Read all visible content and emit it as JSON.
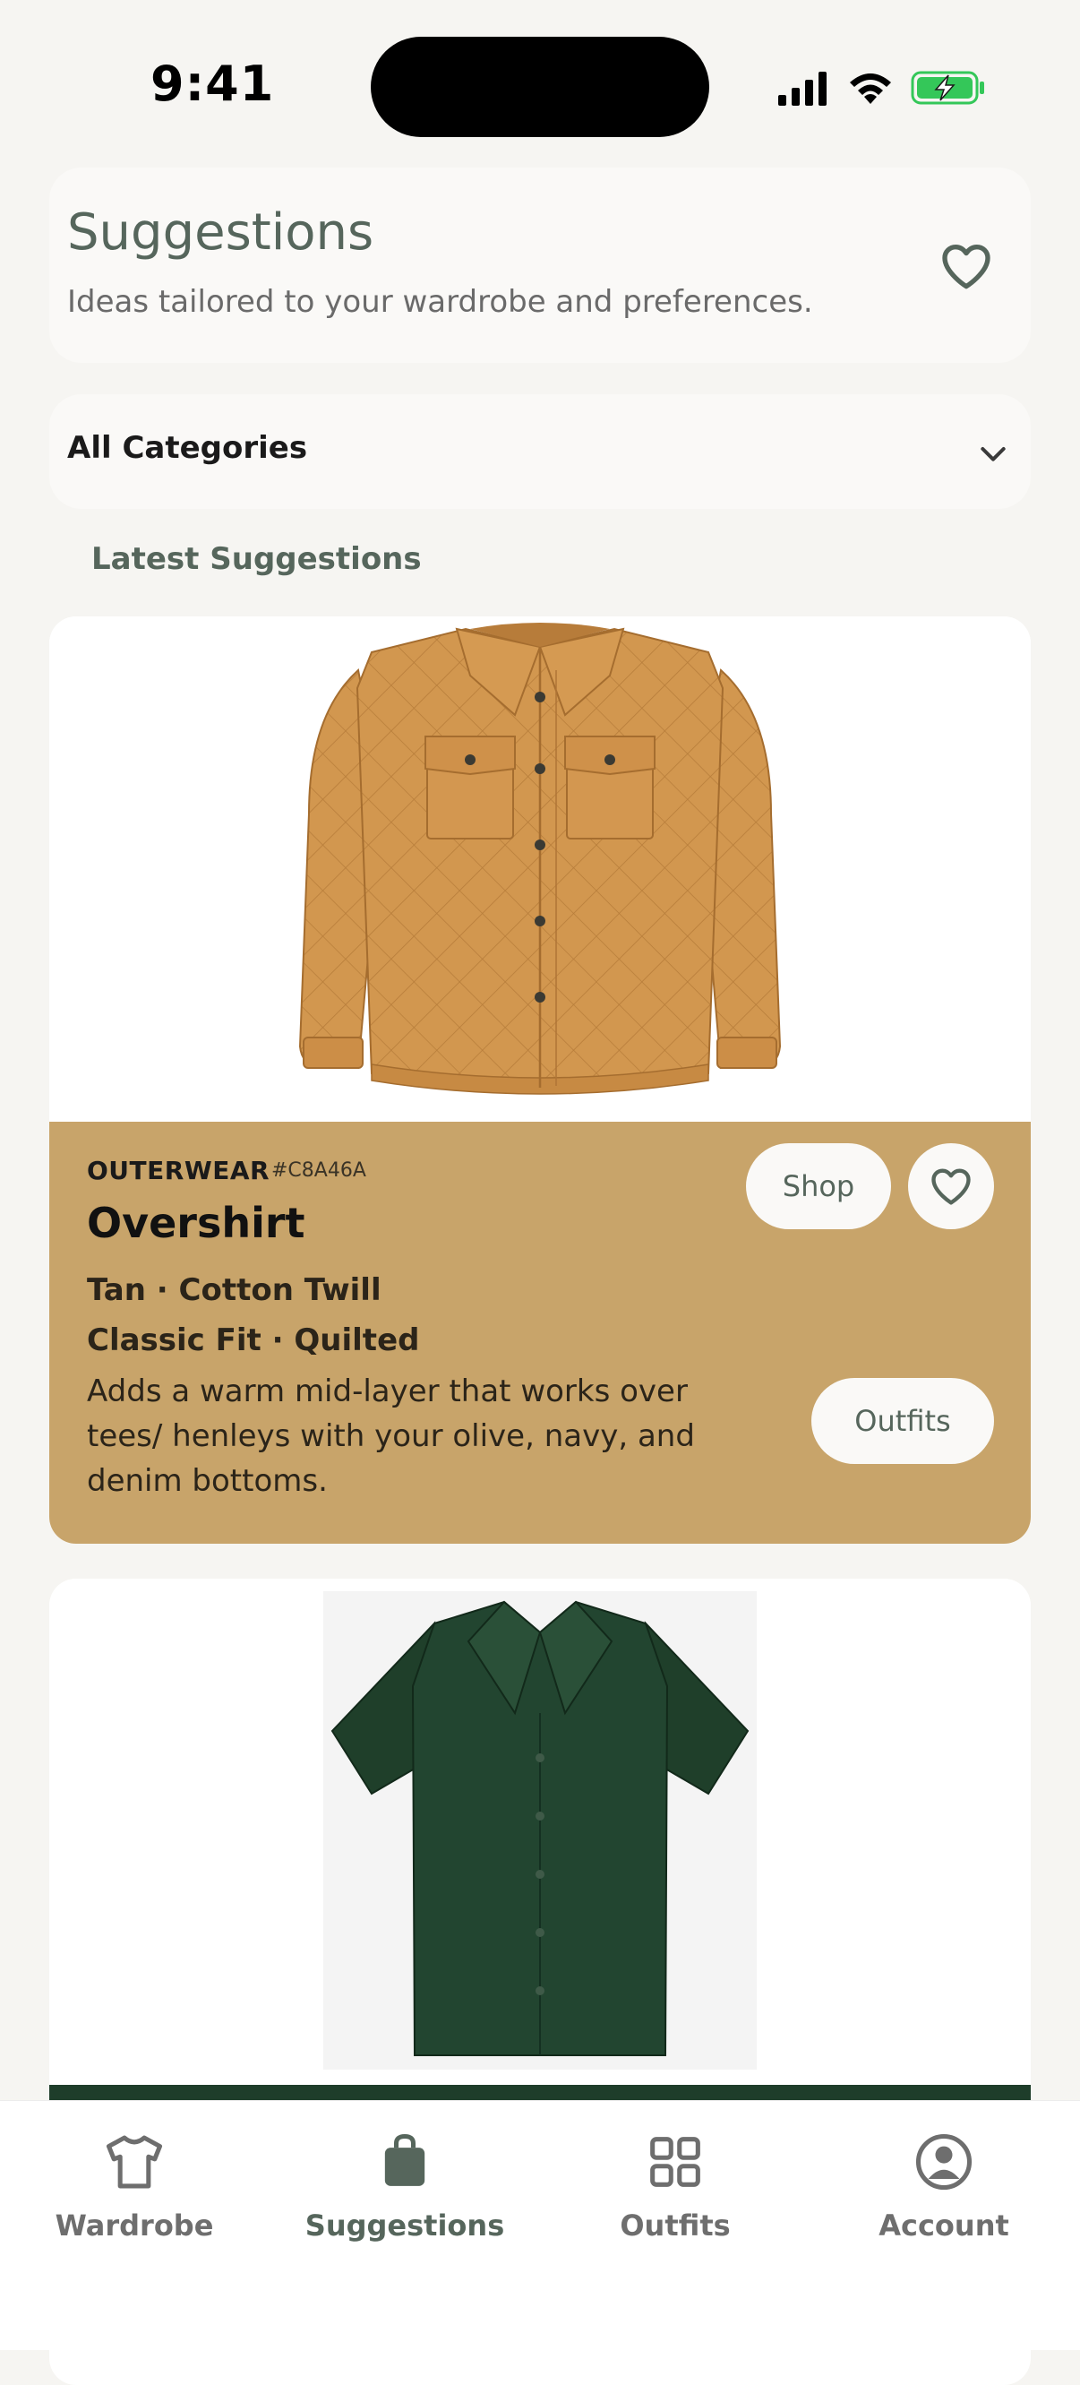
{
  "status_bar": {
    "time": "9:41",
    "icons": [
      "signal-icon",
      "wifi-icon",
      "battery-charging-icon"
    ]
  },
  "header": {
    "title": "Suggestions",
    "subtitle": "Ideas tailored to your wardrobe and preferences.",
    "favorites_icon": "heart-outline-icon"
  },
  "filter": {
    "selected": "All Categories",
    "icon": "chevron-down-icon"
  },
  "section": {
    "title": "Latest Suggestions"
  },
  "suggestions": [
    {
      "category": "OUTERWEAR",
      "hex": "#C8A46A",
      "name": "Overshirt",
      "attr_line_1": "Tan · Cotton Twill",
      "attr_line_2": "Classic Fit · Quilted",
      "description": "Adds a warm mid-layer that works over tees/ henleys with your olive, navy, and denim bottoms.",
      "shop_label": "Shop",
      "outfits_label": "Outfits",
      "image": "tan-quilted-overshirt-image",
      "color": "#C8A46A"
    },
    {
      "image": "dark-green-camp-collar-shirt-image",
      "color": "#1E3D2A"
    }
  ],
  "tab_bar": {
    "items": [
      {
        "label": "Wardrobe",
        "icon": "tshirt-icon",
        "active": false
      },
      {
        "label": "Suggestions",
        "icon": "shopping-bag-icon",
        "active": true
      },
      {
        "label": "Outfits",
        "icon": "grid-icon",
        "active": false
      },
      {
        "label": "Account",
        "icon": "user-circle-icon",
        "active": false
      }
    ]
  },
  "colors": {
    "background": "#f6f5f2",
    "accent_sage": "#56665c",
    "card_tan": "#c8a46a",
    "card_dark_green": "#1e3d2a"
  }
}
